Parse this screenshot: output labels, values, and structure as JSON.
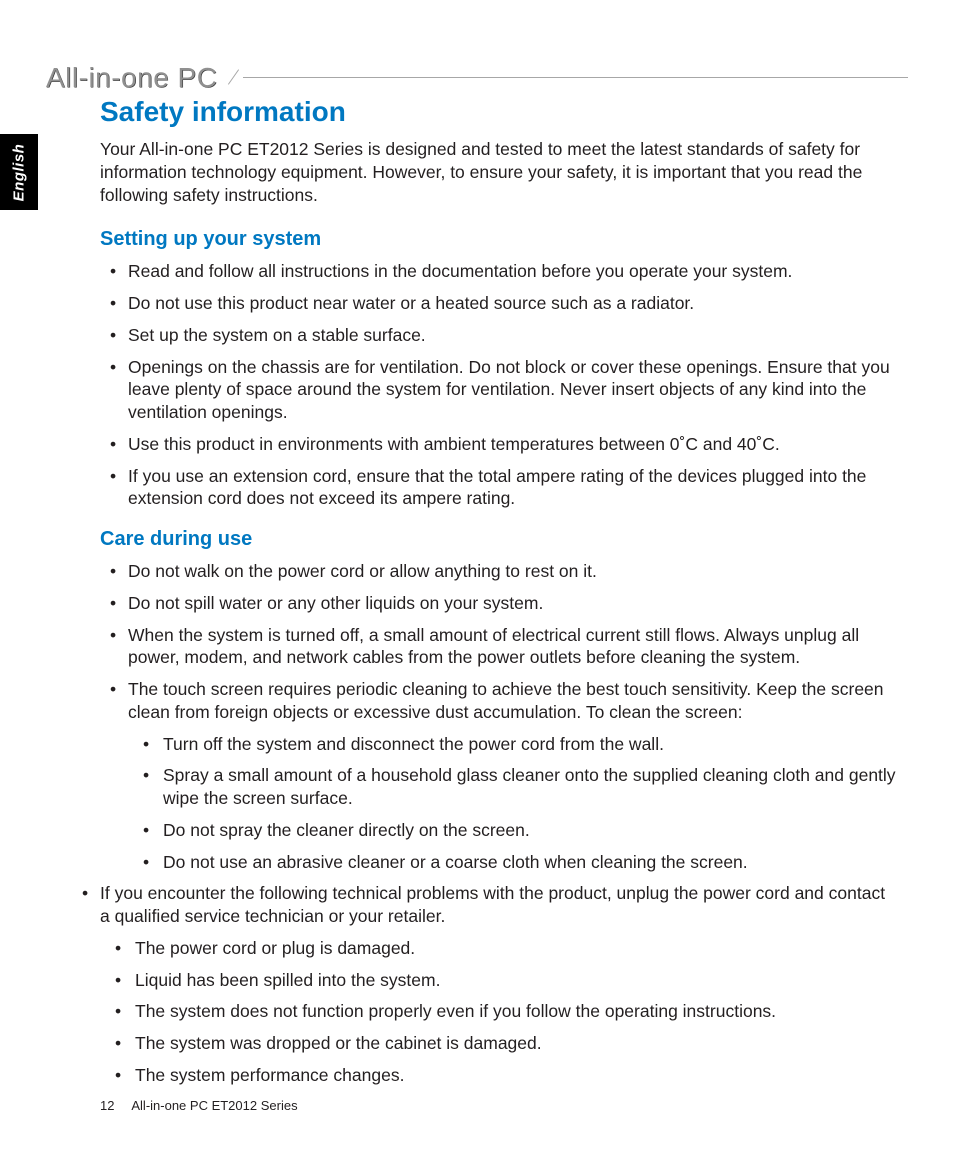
{
  "header": {
    "product_line": "All-in-one PC"
  },
  "language_tab": "English",
  "main": {
    "title": "Safety information",
    "intro": "Your All-in-one PC ET2012 Series is designed and tested to meet the latest standards of safety for information technology equipment. However, to ensure your safety, it is important that you read the following safety instructions.",
    "sections": [
      {
        "heading": "Setting up your system",
        "items": [
          {
            "text": "Read and follow all instructions in the documentation before you operate your system."
          },
          {
            "text": "Do not use this product near water or a heated source such as a radiator."
          },
          {
            "text": "Set up the system on a stable surface."
          },
          {
            "text": "Openings on the chassis are for ventilation. Do not block or cover these openings. Ensure that you leave plenty of space around the system for ventilation. Never insert objects of any kind into the ventilation openings."
          },
          {
            "text": "Use this product in environments with ambient temperatures between 0˚C and 40˚C."
          },
          {
            "text": "If you use an extension cord, ensure that the total ampere rating of the devices plugged into the extension cord does not exceed its ampere rating."
          }
        ]
      },
      {
        "heading": "Care during use",
        "items": [
          {
            "text": "Do not walk on the power cord or allow anything to rest on it."
          },
          {
            "text": "Do not spill water or any other liquids on your system."
          },
          {
            "text": "When the system is turned off, a small amount of electrical current still flows. Always unplug all power, modem, and network cables from the power outlets before cleaning the system."
          },
          {
            "text": "The touch screen requires periodic cleaning to achieve the best touch sensitivity. Keep the screen clean from foreign objects or excessive dust accumulation. To clean the screen:",
            "sub": [
              "Turn off the system and disconnect the power cord from the wall.",
              "Spray a small amount of a household glass cleaner onto the supplied cleaning cloth and gently wipe the screen surface.",
              "Do not spray the cleaner directly on the screen.",
              "Do not use an abrasive cleaner or a coarse cloth when cleaning the screen."
            ]
          },
          {
            "text": "If you encounter the following technical problems with the product, unplug the power cord and contact a qualified service technician or your retailer.",
            "sub": [
              "The power cord or plug is damaged.",
              "Liquid has been spilled into the system.",
              "The system does not function properly even if you follow the operating instructions.",
              "The system was dropped or the cabinet is damaged.",
              "The system performance changes."
            ]
          }
        ]
      }
    ]
  },
  "footer": {
    "page_number": "12",
    "doc_name": "All-in-one PC ET2012 Series"
  }
}
